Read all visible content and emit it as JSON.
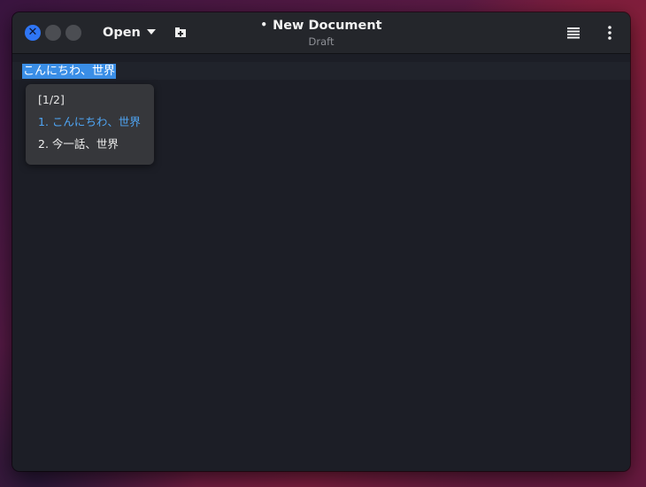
{
  "window": {
    "title": "New Document",
    "subtitle": "Draft",
    "modified_indicator": "•"
  },
  "headerbar": {
    "open_label": "Open",
    "icons": {
      "close": "close-icon",
      "minimize": "minimize-icon",
      "maximize": "maximize-icon",
      "dropdown": "chevron-down-icon",
      "new_tab": "new-tab-icon",
      "menu": "hamburger-menu-icon",
      "more": "kebab-menu-icon"
    },
    "close_glyph": "✕"
  },
  "editor": {
    "text": "こんにちわ、世界",
    "selection_color": "#3a8ee6"
  },
  "ime_popup": {
    "header": "[1/2]",
    "candidates": [
      {
        "label": "1. こんにちわ、世界",
        "selected": true
      },
      {
        "label": "2. 今一話、世界",
        "selected": false
      }
    ],
    "selected_color": "#4fa6f5"
  },
  "colors": {
    "accent": "#2f76f5",
    "headerbar": "#24262b",
    "editor_bg": "#1c1e26",
    "popup_bg": "#36373b"
  }
}
